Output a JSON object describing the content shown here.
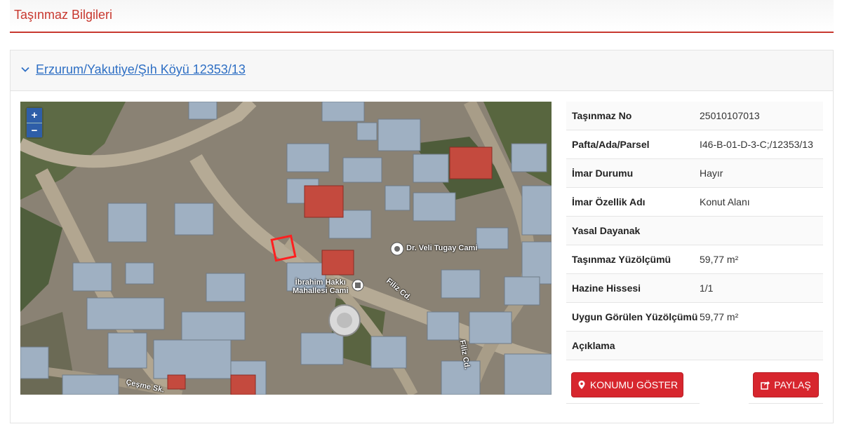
{
  "page": {
    "title": "Taşınmaz Bilgileri"
  },
  "panel": {
    "title": "Erzurum/Yakutiye/Şıh Köyü 12353/13",
    "icon": "chevron-down-icon"
  },
  "map": {
    "zoom_in": "+",
    "zoom_out": "−",
    "labels": {
      "mosque1": "Dr. Veli Tugay Cami",
      "mosque2_line1": "İbrahim Hakkı",
      "mosque2_line2": "Mahallesi Cami",
      "street1": "Filiz Cd.",
      "street2": "Filiz Cd.",
      "street3": "Çeşme Sk."
    }
  },
  "info": {
    "rows": [
      {
        "key": "Taşınmaz No",
        "value": "25010107013"
      },
      {
        "key": "Pafta/Ada/Parsel",
        "value": "I46-B-01-D-3-C;/12353/13"
      },
      {
        "key": "İmar Durumu",
        "value": "Hayır"
      },
      {
        "key": "İmar Özellik Adı",
        "value": "Konut Alanı"
      },
      {
        "key": "Yasal Dayanak",
        "value": ""
      },
      {
        "key": "Taşınmaz Yüzölçümü",
        "value": "59,77 m²"
      },
      {
        "key": "Hazine Hissesi",
        "value": "1/1"
      },
      {
        "key": "Uygun Görülen Yüzölçümü",
        "value": "59,77 m²"
      },
      {
        "key": "Açıklama",
        "value": ""
      }
    ]
  },
  "buttons": {
    "show_location": "KONUMU GÖSTER",
    "share": "PAYLAŞ"
  },
  "colors": {
    "accent": "#c8382f",
    "button": "#d7262e",
    "link": "#2e6fc4"
  }
}
